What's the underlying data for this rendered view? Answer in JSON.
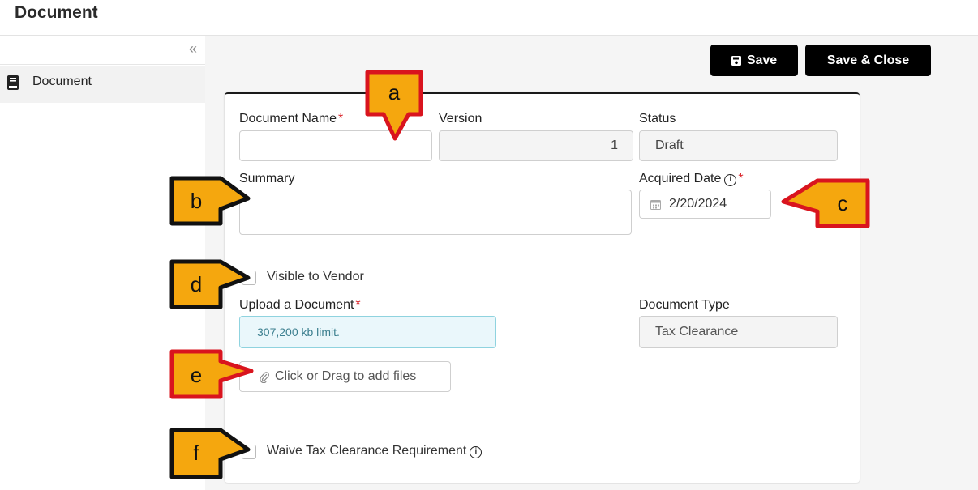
{
  "header": {
    "title": "Document"
  },
  "sidebar": {
    "collapse_glyph": "«",
    "items": [
      {
        "label": "Document",
        "icon": "book-icon"
      }
    ]
  },
  "toolbar": {
    "save_label": "Save",
    "save_close_label": "Save & Close"
  },
  "form": {
    "document_name": {
      "label": "Document Name",
      "value": ""
    },
    "version": {
      "label": "Version",
      "value": "1"
    },
    "status": {
      "label": "Status",
      "value": "Draft"
    },
    "summary": {
      "label": "Summary",
      "value": ""
    },
    "acquired_date": {
      "label": "Acquired Date",
      "value": "2/20/2024"
    },
    "visible_to_vendor": {
      "label": "Visible to Vendor",
      "checked": false
    },
    "upload": {
      "label": "Upload a Document",
      "limit_text": "307,200 kb limit.",
      "add_files_label": "Click or Drag to add files"
    },
    "document_type": {
      "label": "Document Type",
      "value": "Tax Clearance"
    },
    "waive": {
      "label": "Waive Tax Clearance Requirement",
      "checked": false
    },
    "required_marker": "*"
  },
  "callouts": [
    "a",
    "b",
    "c",
    "d",
    "e",
    "f"
  ],
  "colors": {
    "accent_button": "#000000",
    "required": "#d9262c",
    "callout_fill": "#f5a70e",
    "callout_red": "#d9141e",
    "callout_black": "#111111",
    "info_bg": "#eaf7fb"
  }
}
